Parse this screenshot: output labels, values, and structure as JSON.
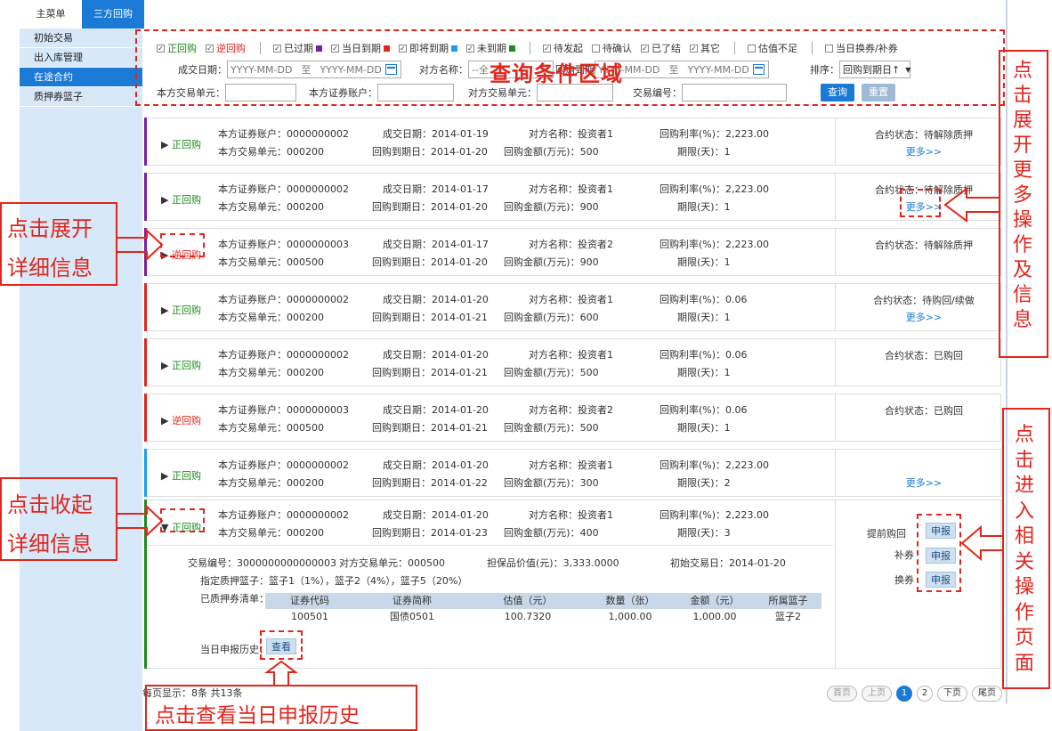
{
  "top_tabs": [
    "主菜单",
    "三方回购"
  ],
  "sidebar": [
    "初始交易",
    "出入库管理",
    "在途合约",
    "质押券篮子"
  ],
  "filters": {
    "row1": [
      {
        "label": "正回购",
        "checked": true,
        "color": "#1f8a1f"
      },
      {
        "label": "逆回购",
        "checked": true,
        "color": "#e0261d"
      },
      {
        "label": "已过期",
        "checked": true,
        "sq": "#7b1fa2"
      },
      {
        "label": "当日到期",
        "checked": true,
        "sq": "#e0261d"
      },
      {
        "label": "即将到期",
        "checked": true,
        "sq": "#1b9ef0"
      },
      {
        "label": "未到期",
        "checked": true,
        "sq": "#1f8a1f"
      },
      {
        "label": "待发起",
        "checked": true
      },
      {
        "label": "待确认",
        "checked": false
      },
      {
        "label": "已了结",
        "checked": true
      },
      {
        "label": "其它",
        "checked": true
      },
      {
        "label": "估值不足",
        "checked": false
      },
      {
        "label": "当日换券/补券",
        "checked": false
      }
    ],
    "trade_date_label": "成交日期：",
    "date_placeholder": "YYYY-MM-DD",
    "to": "至",
    "cp_name_label": "对方名称：",
    "cp_name_value": "--全",
    "due_label": "回购到期",
    "due_from_partial": "Y",
    "sort_label": "排序：",
    "sort_value": "回购到期日↑",
    "own_unit_label": "本方交易单元：",
    "own_acct_label": "本方证券账户：",
    "cp_unit_label": "对方交易单元：",
    "trade_no_label": "交易编号：",
    "query": "查询",
    "reset": "重置"
  },
  "rows": [
    {
      "bar": "#7b1fa2",
      "type": "正回购",
      "acct": "本方证券账户：0000000002",
      "unit": "本方交易单元：000200",
      "date": "成交日期：2014-01-19",
      "due": "回购到期日：2014-01-20",
      "cp": "对方名称：投资者1",
      "amt": "回购金额(万元)：500",
      "rate": "回购利率(%)：2,223.00",
      "days": "期限(天)：1",
      "status": "合约状态：待解除质押",
      "more": "更多>>"
    },
    {
      "bar": "#7b1fa2",
      "type": "正回购",
      "acct": "本方证券账户：0000000002",
      "unit": "本方交易单元：000200",
      "date": "成交日期：2014-01-17",
      "due": "回购到期日：2014-01-20",
      "cp": "对方名称：投资者1",
      "amt": "回购金额(万元)：900",
      "rate": "回购利率(%)：2,223.00",
      "days": "期限(天)：1",
      "status": "合约状态：待解除质押",
      "more": "更多>>"
    },
    {
      "bar": "#7b1fa2",
      "type": "逆回购",
      "acct": "本方证券账户：0000000003",
      "unit": "本方交易单元：000500",
      "date": "成交日期：2014-01-17",
      "due": "回购到期日：2014-01-20",
      "cp": "对方名称：投资者2",
      "amt": "回购金额(万元)：900",
      "rate": "回购利率(%)：2,223.00",
      "days": "期限(天)：1",
      "status": "合约状态：待解除质押",
      "more": ""
    },
    {
      "bar": "#e0261d",
      "type": "正回购",
      "acct": "本方证券账户：0000000002",
      "unit": "本方交易单元：000200",
      "date": "成交日期：2014-01-20",
      "due": "回购到期日：2014-01-21",
      "cp": "对方名称：投资者1",
      "amt": "回购金额(万元)：600",
      "rate": "回购利率(%)：0.06",
      "days": "期限(天)：1",
      "status": "合约状态：待购回/续做",
      "more": "更多>>"
    },
    {
      "bar": "#e0261d",
      "type": "正回购",
      "acct": "本方证券账户：0000000002",
      "unit": "本方交易单元：000200",
      "date": "成交日期：2014-01-20",
      "due": "回购到期日：2014-01-21",
      "cp": "对方名称：投资者1",
      "amt": "回购金额(万元)：500",
      "rate": "回购利率(%)：0.06",
      "days": "期限(天)：1",
      "status": "合约状态：已购回",
      "more": ""
    },
    {
      "bar": "#e0261d",
      "type": "逆回购",
      "acct": "本方证券账户：0000000003",
      "unit": "本方交易单元：000500",
      "date": "成交日期：2014-01-20",
      "due": "回购到期日：2014-01-21",
      "cp": "对方名称：投资者2",
      "amt": "回购金额(万元)：500",
      "rate": "回购利率(%)：0.06",
      "days": "期限(天)：1",
      "status": "合约状态：已购回",
      "more": ""
    },
    {
      "bar": "#1b9ef0",
      "type": "正回购",
      "acct": "本方证券账户：0000000002",
      "unit": "本方交易单元：000200",
      "date": "成交日期：2014-01-20",
      "due": "回购到期日：2014-01-22",
      "cp": "对方名称：投资者1",
      "amt": "回购金额(万元)：300",
      "rate": "回购利率(%)：2,223.00",
      "days": "期限(天)：2",
      "status": "",
      "more": "更多>>"
    }
  ],
  "expanded": {
    "type": "正回购",
    "acct": "本方证券账户：0000000002",
    "unit": "本方交易单元：000200",
    "date": "成交日期：2014-01-20",
    "due": "回购到期日：2014-01-23",
    "cp": "对方名称：投资者1",
    "amt": "回购金额(万元)：400",
    "rate": "回购利率(%)：2,223.00",
    "days": "期限(天)：3",
    "trade_no": "交易编号：3000000000000003",
    "cp_unit": "对方交易单元：000500",
    "collateral": "担保品价值(元)：3,333.0000",
    "init_date": "初始交易日：2014-01-20",
    "baskets": "指定质押篮子：篮子1（1%），篮子2（4%），篮子5（20%）",
    "pledged_label": "已质押券清单：",
    "table_headers": [
      "证券代码",
      "证券简称",
      "估值（元）",
      "数量（张）",
      "金额（元）",
      "所属篮子"
    ],
    "table_row": [
      "100501",
      "国债0501",
      "100.7320",
      "1,000.00",
      "1,000.00",
      "篮子2"
    ],
    "history_label": "当日申报历史：",
    "view": "查看",
    "actions": [
      {
        "label": "提前购回",
        "btn": "申报"
      },
      {
        "label": "补券",
        "btn": "申报"
      },
      {
        "label": "换券",
        "btn": "申报"
      }
    ]
  },
  "footer": {
    "summary": "每页显示：8条  共13条",
    "pages": [
      "首页",
      "上页",
      "1",
      "2",
      "下页",
      "尾页"
    ]
  },
  "annotations": {
    "query_area": "查询条件区域",
    "expand_detail": [
      "点击展开",
      "详细信息"
    ],
    "collapse_detail": [
      "点击收起",
      "详细信息"
    ],
    "more_ops": "点击展开更多操作及信息",
    "enter_ops": "点击进入相关操作页面",
    "view_history": "点击查看当日申报历史"
  }
}
